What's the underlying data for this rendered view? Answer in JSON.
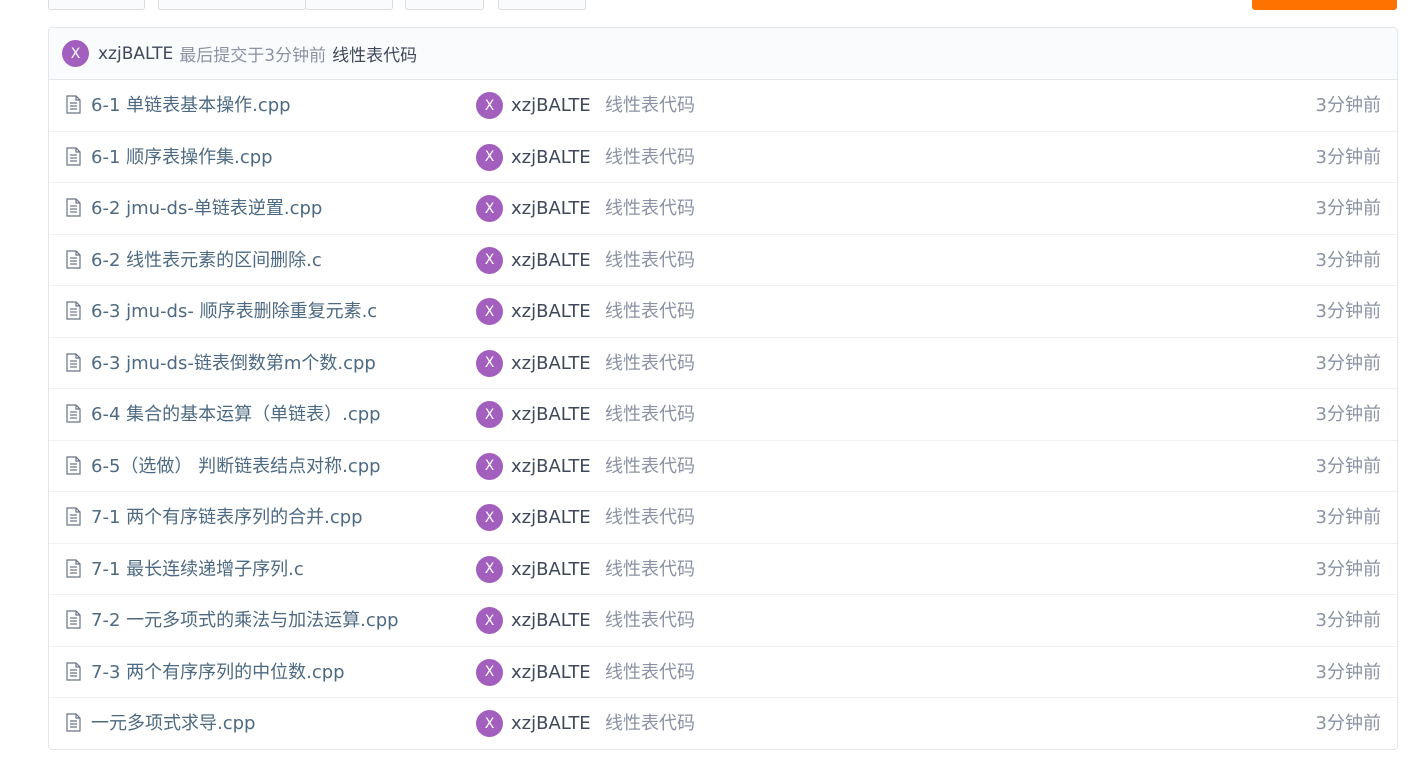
{
  "top_toolbar": {
    "accent_color": "#fe7300"
  },
  "latest_commit": {
    "avatar_letter": "X",
    "author": "xzjBALTE",
    "text": "最后提交于",
    "ago": "3分钟前",
    "message": "线性表代码"
  },
  "files": [
    {
      "name": "6-1 单链表基本操作.cpp",
      "avatar": "X",
      "author": "xzjBALTE",
      "message": "线性表代码",
      "time": "3分钟前"
    },
    {
      "name": "6-1 顺序表操作集.cpp",
      "avatar": "X",
      "author": "xzjBALTE",
      "message": "线性表代码",
      "time": "3分钟前"
    },
    {
      "name": "6-2 jmu-ds-单链表逆置.cpp",
      "avatar": "X",
      "author": "xzjBALTE",
      "message": "线性表代码",
      "time": "3分钟前"
    },
    {
      "name": "6-2 线性表元素的区间删除.c",
      "avatar": "X",
      "author": "xzjBALTE",
      "message": "线性表代码",
      "time": "3分钟前"
    },
    {
      "name": "6-3 jmu-ds- 顺序表删除重复元素.c",
      "avatar": "X",
      "author": "xzjBALTE",
      "message": "线性表代码",
      "time": "3分钟前"
    },
    {
      "name": "6-3 jmu-ds-链表倒数第m个数.cpp",
      "avatar": "X",
      "author": "xzjBALTE",
      "message": "线性表代码",
      "time": "3分钟前"
    },
    {
      "name": "6-4 集合的基本运算（单链表）.cpp",
      "avatar": "X",
      "author": "xzjBALTE",
      "message": "线性表代码",
      "time": "3分钟前"
    },
    {
      "name": "6-5（选做） 判断链表结点对称.cpp",
      "avatar": "X",
      "author": "xzjBALTE",
      "message": "线性表代码",
      "time": "3分钟前"
    },
    {
      "name": "7-1 两个有序链表序列的合并.cpp",
      "avatar": "X",
      "author": "xzjBALTE",
      "message": "线性表代码",
      "time": "3分钟前"
    },
    {
      "name": "7-1 最长连续递增子序列.c",
      "avatar": "X",
      "author": "xzjBALTE",
      "message": "线性表代码",
      "time": "3分钟前"
    },
    {
      "name": "7-2 一元多项式的乘法与加法运算.cpp",
      "avatar": "X",
      "author": "xzjBALTE",
      "message": "线性表代码",
      "time": "3分钟前"
    },
    {
      "name": "7-3 两个有序序列的中位数.cpp",
      "avatar": "X",
      "author": "xzjBALTE",
      "message": "线性表代码",
      "time": "3分钟前"
    },
    {
      "name": "一元多项式求导.cpp",
      "avatar": "X",
      "author": "xzjBALTE",
      "message": "线性表代码",
      "time": "3分钟前"
    }
  ]
}
